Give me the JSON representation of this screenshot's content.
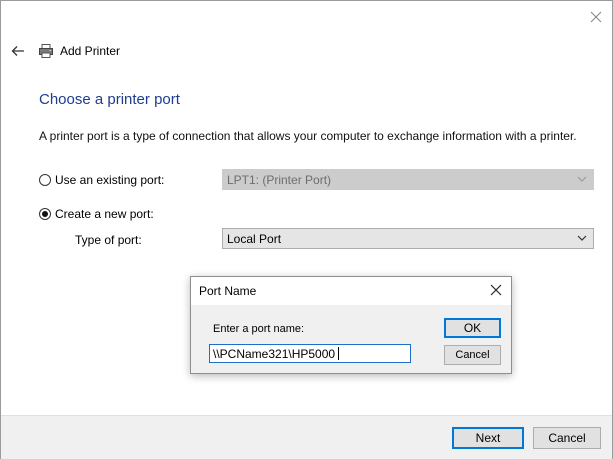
{
  "window": {
    "close_icon": "close-icon",
    "header": {
      "title": "Add Printer",
      "back_icon": "back-arrow-icon",
      "printer_icon": "printer-icon"
    }
  },
  "page": {
    "heading": "Choose a printer port",
    "description": "A printer port is a type of connection that allows your computer to exchange information with a printer."
  },
  "options": {
    "existing": {
      "label": "Use an existing port:",
      "selected": false,
      "value": "LPT1: (Printer Port)",
      "disabled": true
    },
    "new": {
      "label": "Create a new port:",
      "selected": true,
      "type_label": "Type of port:",
      "type_value": "Local Port"
    }
  },
  "footer": {
    "next_label": "Next",
    "cancel_label": "Cancel"
  },
  "dialog": {
    "title": "Port Name",
    "prompt": "Enter a port name:",
    "input_value": "\\\\PCName321\\HP5000",
    "ok_label": "OK",
    "cancel_label": "Cancel"
  },
  "colors": {
    "heading": "#1e3d8f",
    "focus_border": "#0078d7",
    "disabled_select": "#cccccc"
  }
}
